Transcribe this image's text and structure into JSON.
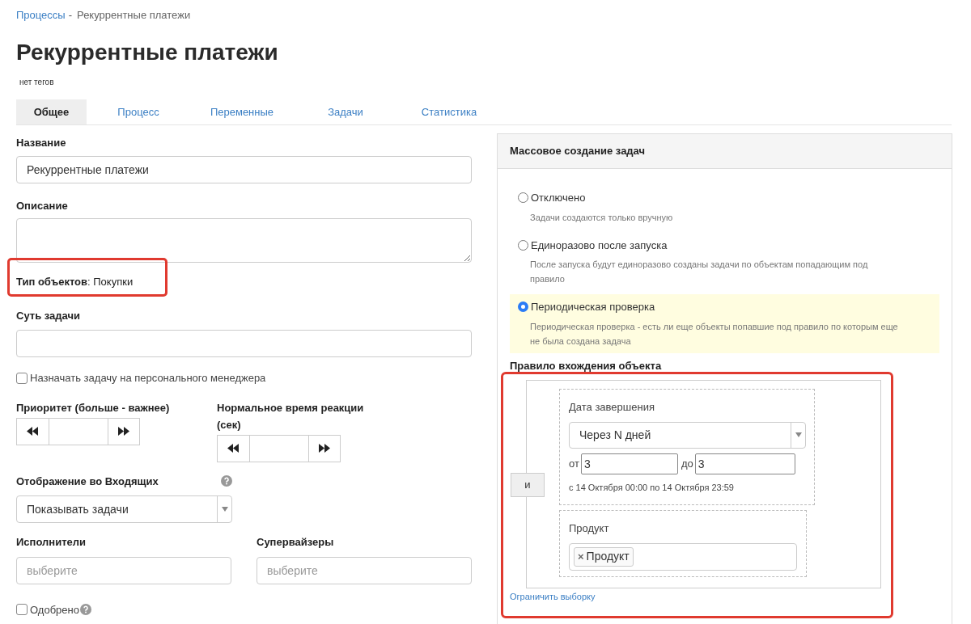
{
  "breadcrumb": {
    "link": "Процессы",
    "separator": "-",
    "current": "Рекуррентные платежи"
  },
  "title": "Рекуррентные платежи",
  "tags_note": "нет тегов",
  "tabs": [
    {
      "label": "Общее",
      "selected": true
    },
    {
      "label": "Процесс",
      "selected": false
    },
    {
      "label": "Переменные",
      "selected": false
    },
    {
      "label": "Задачи",
      "selected": false
    },
    {
      "label": "Статистика",
      "selected": false
    }
  ],
  "form": {
    "name": {
      "label": "Название",
      "value": "Рекуррентные платежи"
    },
    "description": {
      "label": "Описание"
    },
    "object_type": "**Тип объектов**: Покупки",
    "task_essence": {
      "label": "Суть задачи"
    },
    "personal_manager": {
      "label": "Назначать задачу на персонального менеджера",
      "checked": false
    },
    "priority": {
      "label": "Приоритет (больше - важнее)"
    },
    "reaction_time": {
      "label": "Нормальное время реакции (сек)"
    },
    "inbox_display": {
      "label": "Отображение во Входящих",
      "value": "Показывать задачи"
    },
    "executors": {
      "label": "Исполнители",
      "placeholder": "выберите"
    },
    "supervisors": {
      "label": "Супервайзеры",
      "placeholder": "выберите"
    },
    "approved": {
      "label": "Одобрено",
      "checked": false
    }
  },
  "mass_creation": {
    "title": "Массовое создание задач",
    "options": [
      {
        "label": "Отключено",
        "description": "Задачи создаются только вручную",
        "selected": false
      },
      {
        "label": "Единоразово после запуска",
        "description": "После запуска будут единоразово созданы задачи по объектам попадающим под правило",
        "selected": false
      },
      {
        "label": "Периодическая проверка",
        "description": "Периодическая проверка - есть ли еще объекты попавшие под правило по которым еще не была создана задача",
        "selected": true
      }
    ],
    "rule": {
      "title": "Правило вхождения объекта",
      "operator": "и",
      "conditions": [
        {
          "kind": "date",
          "label": "Дата завершения",
          "select_value": "Через N дней",
          "from_label": "от",
          "from_value": "3",
          "to_label": "до",
          "to_value": "3",
          "range_text": "с 14 Октября 00:00 по 14 Октября 23:59"
        },
        {
          "kind": "tags",
          "label": "Продукт",
          "tags": [
            {
              "remove": "×",
              "label": "Продукт"
            }
          ]
        }
      ],
      "limit_link": "Ограничить выборку"
    }
  }
}
